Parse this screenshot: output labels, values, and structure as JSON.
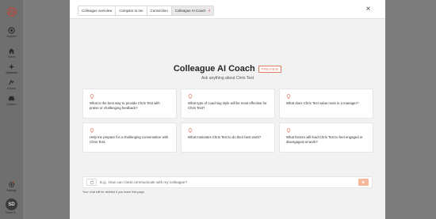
{
  "colors": {
    "accent": "#e07a5f",
    "send_button": "#f6b79a",
    "overlay": "#7d7d7d"
  },
  "sidebar": {
    "items": [
      {
        "label": "Support",
        "icon": "support-icon",
        "active": false
      },
      {
        "label": "Home",
        "icon": "home-icon",
        "active": false
      },
      {
        "label": "Connect",
        "icon": "connect-icon",
        "active": true
      },
      {
        "label": "Assess",
        "icon": "assess-icon",
        "active": false
      },
      {
        "label": "Explore",
        "icon": "explore-icon",
        "active": false
      }
    ],
    "settings_label": "Settings",
    "avatar_initials": "SD",
    "avatar_label": "Sonia D..."
  },
  "header": {
    "tabs": [
      {
        "label": "Colleague overview",
        "active": false
      },
      {
        "label": "Compare to me",
        "active": false
      },
      {
        "label": "Connection",
        "active": false
      },
      {
        "label": "Colleague AI Coach",
        "active": true,
        "closable": true
      }
    ],
    "tab_close_glyph": "×",
    "close_glyph": "×"
  },
  "main": {
    "title": "Colleague AI Coach",
    "badge": "PREVIEW",
    "subtitle": "Ask anything about Chris Test",
    "suggestions": [
      "What is the best way to provide Chris Test with praise or challenging feedback?",
      "What type of coaching style will be most effective for Chris Test?",
      "What does Chris Test value most in a manager?",
      "Help me prepare for a challenging conversation with Chris Test.",
      "What motivates Chris Test to do their best work?",
      "What factors will lead Chris Test to feel engaged or disengaged at work?"
    ],
    "chat": {
      "placeholder": "E.g., How can I best communicate with my colleague?",
      "value": ""
    },
    "notice": "Your chat will be deleted if you leave this page."
  }
}
